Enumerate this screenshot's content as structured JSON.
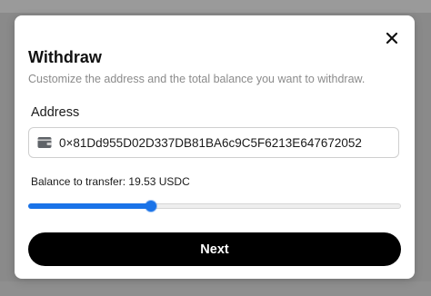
{
  "dialog": {
    "title": "Withdraw",
    "subtitle": "Customize the address and the total balance you want to withdraw.",
    "close_icon": "close-icon"
  },
  "address": {
    "label": "Address",
    "value": "0×81Dd955D02D337DB81BA6c9C5F6213E647672052",
    "icon": "wallet-icon"
  },
  "balance": {
    "text": "Balance to transfer: 19.53 USDC",
    "slider_fraction": 0.33
  },
  "actions": {
    "next_label": "Next"
  },
  "colors": {
    "accent": "#1a73e8",
    "button_bg": "#000000",
    "button_text": "#ffffff",
    "backdrop": "#8a8a8a"
  }
}
